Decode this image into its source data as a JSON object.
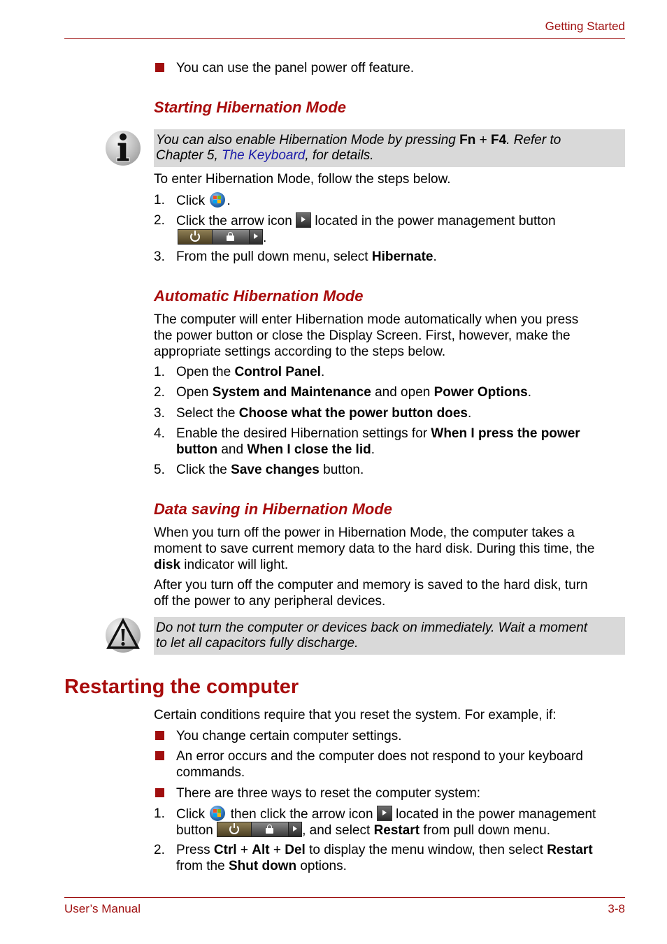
{
  "header": {
    "section_title": "Getting Started"
  },
  "footer": {
    "manual_title": "User’s Manual",
    "page_number": "3-8"
  },
  "intro_bullet": "You can use the panel power off feature.",
  "starting_hibernation": {
    "heading": "Starting Hibernation Mode",
    "note": {
      "icon": "info-icon",
      "line1_a": "You can also enable Hibernation Mode by pressing ",
      "key1": "Fn",
      "plus": " + ",
      "key2": "F4",
      "line1_b": ". Refer to",
      "line2_a": "Chapter 5, ",
      "link": "The Keyboard",
      "line2_b": ", for details."
    },
    "lead": "To enter Hibernation Mode, follow the steps below.",
    "steps": [
      {
        "num": "1.",
        "text_a": "Click ",
        "icon": "windows-start-orb-icon",
        "text_b": "."
      },
      {
        "num": "2.",
        "text_a": "Click the arrow icon ",
        "icon": "arrow-icon",
        "text_b": " located in the power management button",
        "text_c": "."
      },
      {
        "num": "3.",
        "text_a": "From the pull down menu, select ",
        "bold": "Hibernate",
        "text_b": "."
      }
    ]
  },
  "automatic_hibernation": {
    "heading": "Automatic Hibernation Mode",
    "paragraph_lines": [
      "The computer will enter Hibernation mode automatically when you press",
      "the power button or close the Display Screen. First, however, make the",
      "appropriate settings according to the steps below."
    ],
    "steps": [
      {
        "num": "1.",
        "a": "Open the ",
        "b1": "Control Panel",
        "c": "."
      },
      {
        "num": "2.",
        "a": "Open ",
        "b1": "System and Maintenance",
        "c": " and open ",
        "b2": "Power Options",
        "d": "."
      },
      {
        "num": "3.",
        "a": "Select the ",
        "b1": "Choose what the power button does",
        "c": "."
      },
      {
        "num": "4.",
        "a": "Enable the desired Hibernation settings for ",
        "b1": "When I press the power",
        "b1_cont": "button",
        "c": " and ",
        "b2": "When I close the lid",
        "d": "."
      },
      {
        "num": "5.",
        "a": "Click the ",
        "b1": "Save changes",
        "c": " button."
      }
    ]
  },
  "data_saving": {
    "heading": "Data saving in Hibernation Mode",
    "para1_lines": [
      "When you turn off the power in Hibernation Mode, the computer takes a",
      "moment to save current memory data to the hard disk. During this time, the"
    ],
    "para1_bold": "disk",
    "para1_end": " indicator will light.",
    "para2_lines": [
      "After you turn off the computer and memory is saved to the hard disk, turn",
      "off the power to any peripheral devices."
    ],
    "caution": {
      "icon": "warning-icon",
      "line1": "Do not turn the computer or devices back on immediately. Wait a moment",
      "line2": "to let all capacitors fully discharge."
    }
  },
  "restarting": {
    "heading": "Restarting the computer",
    "lead": "Certain conditions require that you reset the system. For example, if:",
    "bullets": [
      {
        "line1": "You change certain computer settings."
      },
      {
        "line1": "An error occurs and the computer does not respond to your keyboard",
        "line2": "commands."
      },
      {
        "line1": "There are three ways to reset the computer system:"
      }
    ],
    "steps": {
      "s1": {
        "num": "1.",
        "a": "Click ",
        "b": " then click the arrow icon ",
        "c": " located in the power management",
        "d": "button ",
        "e": ", and select ",
        "bold": "Restart",
        "f": " from pull down menu."
      },
      "s2": {
        "num": "2.",
        "a": "Press ",
        "k1": "Ctrl",
        "p1": " + ",
        "k2": "Alt",
        "p2": " + ",
        "k3": "Del",
        "b": " to display the menu window, then select ",
        "k4": "Restart",
        "c": "from the ",
        "k5": "Shut down",
        "d": " options."
      }
    }
  }
}
